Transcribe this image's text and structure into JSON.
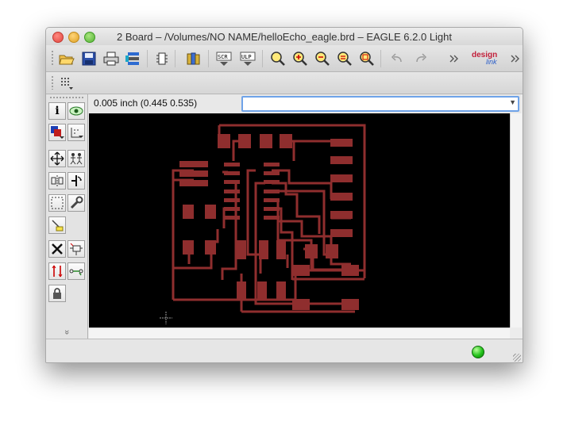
{
  "window": {
    "title": "2 Board – /Volumes/NO NAME/helloEcho_eagle.brd – EAGLE 6.2.0 Light"
  },
  "toolbar": {
    "buttons": [
      "open-icon",
      "save-icon",
      "print-icon",
      "cam-icon",
      "board-schematic-switch-icon",
      "library-icon",
      "run-script-icon",
      "run-ulp-icon",
      "zoom-fit-icon",
      "zoom-in-icon",
      "zoom-out-icon",
      "zoom-redraw-icon",
      "zoom-select-icon",
      "undo-icon",
      "redo-icon",
      "overflow-icon",
      "designlink-icon",
      "overflow-icon-2"
    ],
    "designlink_line1": "design",
    "designlink_line2": "link"
  },
  "toolbar2": {
    "buttons": [
      "grid-icon"
    ]
  },
  "coordinates": {
    "readout": "0.005 inch (0.445 0.535)"
  },
  "command_line": {
    "value": "",
    "placeholder": ""
  },
  "left_toolbar": {
    "buttons": [
      "info-icon",
      "show-icon",
      "display-layers-icon",
      "mark-icon",
      "move-icon",
      "copy-icon",
      "mirror-icon",
      "rotate-icon",
      "group-icon",
      "change-icon",
      "paste-icon",
      "delete-icon",
      "add-icon",
      "replace-icon",
      "pinswap-icon",
      "lock-icon",
      "more-tools-icon"
    ],
    "more_label": "»"
  },
  "colors": {
    "trace": "#8f2e2e",
    "canvas_bg": "#000000",
    "status_ok": "#22c21a"
  },
  "status": {
    "indicator": "ready"
  }
}
